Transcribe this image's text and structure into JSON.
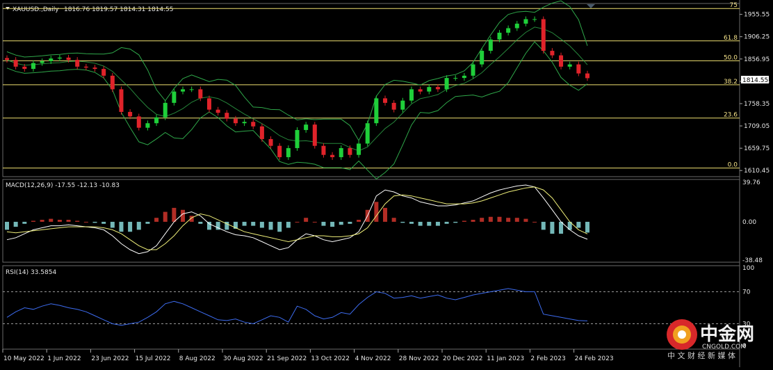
{
  "header": {
    "symbol": "XAUUSD.,Daily",
    "ohlc": "1816.76 1819.57 1814.31 1814.55",
    "collapse_icon": "triangle-down-icon"
  },
  "price_axis": {
    "ticks": [
      "1955.55",
      "1906.25",
      "1856.95",
      "1807.65",
      "1758.35",
      "1709.05",
      "1659.75",
      "1610.45"
    ],
    "current_price": "1814.55"
  },
  "fibonacci": {
    "levels": [
      {
        "label": "75",
        "price": 1968.5
      },
      {
        "label": "61.8",
        "price": 1897.0
      },
      {
        "label": "50.0",
        "price": 1853.0
      },
      {
        "label": "38.2",
        "price": 1800.0
      },
      {
        "label": "23.6",
        "price": 1726.5
      },
      {
        "label": "0.0",
        "price": 1616.0
      }
    ]
  },
  "macd": {
    "title": "MACD(12,26,9) -17.55 -12.13 -10.83",
    "ticks": [
      "39.76",
      "0.00",
      "-38.48"
    ]
  },
  "rsi": {
    "title": "RSI(14) 33.5854",
    "ticks": [
      "100",
      "70",
      "30",
      "0"
    ]
  },
  "date_axis": [
    "10 May 2022",
    "1 Jun 2022",
    "23 Jun 2022",
    "15 Jul 2022",
    "8 Aug 2022",
    "30 Aug 2022",
    "21 Sep 2022",
    "13 Oct 2022",
    "4 Nov 2022",
    "28 Nov 2022",
    "20 Dec 2022",
    "11 Jan 2023",
    "2 Feb 2023",
    "24 Feb 2023"
  ],
  "watermark": {
    "brand": "中金网",
    "domain": "CNGOLD.COM",
    "tagline": "中 文 财 经 新 媒 体"
  },
  "colors": {
    "background": "#000000",
    "bull_candle": "#1fcf3a",
    "bear_candle": "#e0232a",
    "bands": "#2fa84a",
    "fib_lines": "#f0e070",
    "macd_hist_pos": "#d0352b",
    "macd_hist_neg": "#88d8d8",
    "macd_line": "#ffffff",
    "signal_line": "#f0f07a",
    "rsi_line": "#3d6cf0"
  },
  "chart_data": [
    {
      "type": "candlestick",
      "title": "XAUUSD.,Daily",
      "x": [
        "10 May 2022",
        "13 May 2022",
        "18 May 2022",
        "23 May 2022",
        "26 May 2022",
        "1 Jun 2022",
        "6 Jun 2022",
        "9 Jun 2022",
        "14 Jun 2022",
        "17 Jun 2022",
        "23 Jun 2022",
        "28 Jun 2022",
        "1 Jul 2022",
        "6 Jul 2022",
        "11 Jul 2022",
        "15 Jul 2022",
        "20 Jul 2022",
        "25 Jul 2022",
        "29 Jul 2022",
        "3 Aug 2022",
        "8 Aug 2022",
        "12 Aug 2022",
        "17 Aug 2022",
        "22 Aug 2022",
        "26 Aug 2022",
        "30 Aug 2022",
        "5 Sep 2022",
        "9 Sep 2022",
        "14 Sep 2022",
        "19 Sep 2022",
        "21 Sep 2022",
        "26 Sep 2022",
        "29 Sep 2022",
        "4 Oct 2022",
        "7 Oct 2022",
        "13 Oct 2022",
        "18 Oct 2022",
        "21 Oct 2022",
        "26 Oct 2022",
        "31 Oct 2022",
        "4 Nov 2022",
        "9 Nov 2022",
        "14 Nov 2022",
        "18 Nov 2022",
        "23 Nov 2022",
        "28 Nov 2022",
        "2 Dec 2022",
        "7 Dec 2022",
        "12 Dec 2022",
        "15 Dec 2022",
        "20 Dec 2022",
        "23 Dec 2022",
        "29 Dec 2022",
        "4 Jan 2023",
        "9 Jan 2023",
        "11 Jan 2023",
        "16 Jan 2023",
        "20 Jan 2023",
        "25 Jan 2023",
        "30 Jan 2023",
        "2 Feb 2023",
        "7 Feb 2023",
        "10 Feb 2023",
        "15 Feb 2023",
        "20 Feb 2023",
        "24 Feb 2023",
        "1 Mar 2023"
      ],
      "close": [
        1855,
        1840,
        1835,
        1848,
        1852,
        1858,
        1860,
        1855,
        1840,
        1838,
        1835,
        1820,
        1790,
        1740,
        1730,
        1705,
        1715,
        1728,
        1760,
        1785,
        1790,
        1790,
        1770,
        1745,
        1738,
        1725,
        1715,
        1718,
        1708,
        1680,
        1665,
        1640,
        1660,
        1700,
        1712,
        1665,
        1645,
        1640,
        1660,
        1645,
        1670,
        1715,
        1770,
        1760,
        1745,
        1765,
        1790,
        1785,
        1795,
        1790,
        1815,
        1815,
        1820,
        1845,
        1875,
        1900,
        1915,
        1925,
        1935,
        1945,
        1945,
        1875,
        1865,
        1840,
        1845,
        1825,
        1814.55
      ],
      "ylim": [
        1600,
        1975
      ]
    },
    {
      "type": "line",
      "title": "MACD(12,26,9) -17.55 -12.13 -10.83",
      "series": [
        {
          "name": "MACD",
          "values": [
            -18,
            -16,
            -12,
            -8,
            -6,
            -4,
            -4,
            -3,
            -4,
            -5,
            -6,
            -8,
            -14,
            -22,
            -28,
            -32,
            -30,
            -24,
            -12,
            0,
            8,
            10,
            6,
            -2,
            -6,
            -10,
            -13,
            -14,
            -16,
            -20,
            -24,
            -28,
            -26,
            -18,
            -12,
            -14,
            -18,
            -20,
            -18,
            -16,
            -10,
            6,
            26,
            32,
            30,
            26,
            24,
            20,
            18,
            16,
            16,
            17,
            19,
            21,
            25,
            29,
            32,
            34,
            36,
            37,
            35,
            24,
            12,
            0,
            -8,
            -14,
            -17.55
          ]
        },
        {
          "name": "Signal",
          "values": [
            -10,
            -11,
            -10,
            -9,
            -8,
            -7,
            -6,
            -5,
            -5,
            -5,
            -5,
            -6,
            -8,
            -12,
            -18,
            -24,
            -28,
            -28,
            -22,
            -14,
            -4,
            4,
            8,
            6,
            2,
            -2,
            -6,
            -10,
            -12,
            -14,
            -16,
            -18,
            -20,
            -18,
            -16,
            -14,
            -14,
            -15,
            -15,
            -14,
            -12,
            -6,
            6,
            18,
            26,
            27,
            26,
            24,
            22,
            20,
            18,
            18,
            18,
            19,
            21,
            24,
            27,
            30,
            32,
            34,
            35,
            32,
            24,
            12,
            0,
            -8,
            -12.13
          ]
        }
      ],
      "histogram": [
        -8,
        -5,
        -2,
        1,
        2,
        3,
        2,
        2,
        1,
        0,
        -1,
        -2,
        -6,
        -10,
        -10,
        -8,
        -2,
        4,
        10,
        14,
        12,
        6,
        -2,
        -8,
        -8,
        -8,
        -7,
        -4,
        -4,
        -6,
        -8,
        -10,
        -6,
        0,
        4,
        0,
        -4,
        -5,
        -3,
        -2,
        2,
        12,
        20,
        14,
        4,
        -1,
        -2,
        -4,
        -4,
        -4,
        -2,
        -1,
        1,
        2,
        4,
        5,
        5,
        4,
        4,
        3,
        0,
        -8,
        -12,
        -12,
        -8,
        -6,
        -10.83
      ],
      "ylim": [
        -38.48,
        39.76
      ]
    },
    {
      "type": "line",
      "title": "RSI(14) 33.5854",
      "series": [
        {
          "name": "RSI(14)",
          "values": [
            38,
            45,
            50,
            48,
            52,
            55,
            53,
            50,
            48,
            45,
            40,
            35,
            30,
            28,
            30,
            32,
            38,
            45,
            55,
            58,
            55,
            50,
            45,
            40,
            35,
            34,
            36,
            32,
            30,
            35,
            40,
            38,
            32,
            52,
            48,
            40,
            36,
            38,
            44,
            42,
            54,
            63,
            70,
            68,
            62,
            63,
            65,
            62,
            64,
            66,
            62,
            60,
            63,
            66,
            68,
            70,
            72,
            74,
            72,
            70,
            70,
            42,
            40,
            38,
            36,
            34,
            33.59
          ]
        }
      ],
      "ylim": [
        0,
        100
      ]
    }
  ]
}
